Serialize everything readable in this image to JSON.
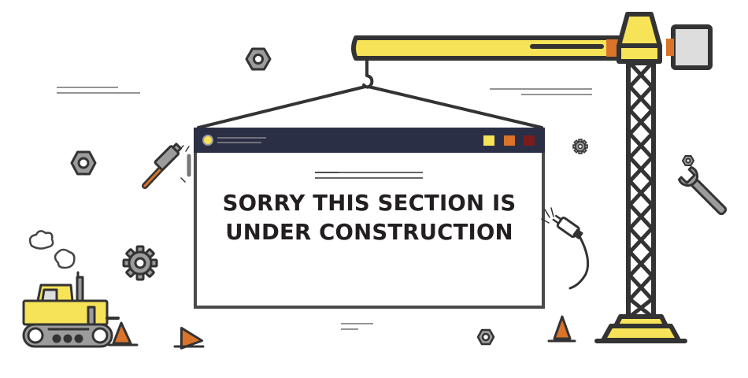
{
  "message": {
    "line1": "SORRY THIS SECTION IS",
    "line2": "UNDER CONSTRUCTION"
  },
  "colors": {
    "outline": "#333333",
    "yellow": "#f7e357",
    "orange": "#d9742a",
    "dark_red": "#7a1c1c",
    "navy": "#2b2f45",
    "grey": "#9c9c9c",
    "light_grey": "#dddddd"
  },
  "icons": [
    "tower-crane-icon",
    "browser-window-icon",
    "bulldozer-icon",
    "hammer-icon",
    "wrench-icon",
    "power-plug-icon",
    "gear-icon",
    "hex-nut-icon",
    "traffic-cone-icon",
    "smoke-cloud-icon"
  ]
}
